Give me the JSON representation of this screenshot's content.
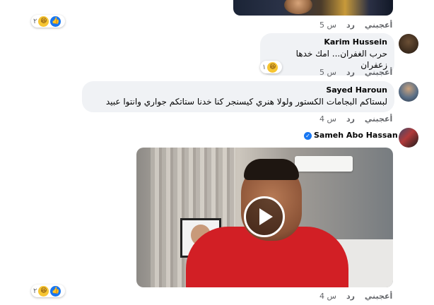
{
  "top_media": {
    "alt": ""
  },
  "reaction_pill_1": {
    "count": "٢"
  },
  "comment_0_actions": {
    "like": "أعجبني",
    "reply": "رد",
    "time": "5 س"
  },
  "comments": [
    {
      "author": "Karim Hussein",
      "text": "حرب الغفران... امك خدها زعفران",
      "reaction_count": "١",
      "actions": {
        "like": "أعجبني",
        "reply": "رد",
        "time": "5 س"
      }
    },
    {
      "author": "Sayed Haroun",
      "text": "لبستاكم البجامات الكستور ولولا هنري كيسنجر كنا خدنا ستاتكم جواري وانتوا عبيد",
      "actions": {
        "like": "أعجبني",
        "reply": "رد",
        "time": "4 س"
      }
    },
    {
      "author": "Sameh Abo Hassan",
      "verified": true,
      "reaction_count": "٢",
      "actions": {
        "like": "أعجبني",
        "reply": "رد",
        "time": "4 س"
      }
    }
  ],
  "colors": {
    "like_blue": "#1877f2",
    "haha_yellow": "#f7c531",
    "shirt_red": "#d21f25",
    "bubble_gray": "#f0f2f5"
  },
  "icons": [
    "like-icon",
    "haha-icon",
    "play-icon",
    "verified-icon"
  ]
}
